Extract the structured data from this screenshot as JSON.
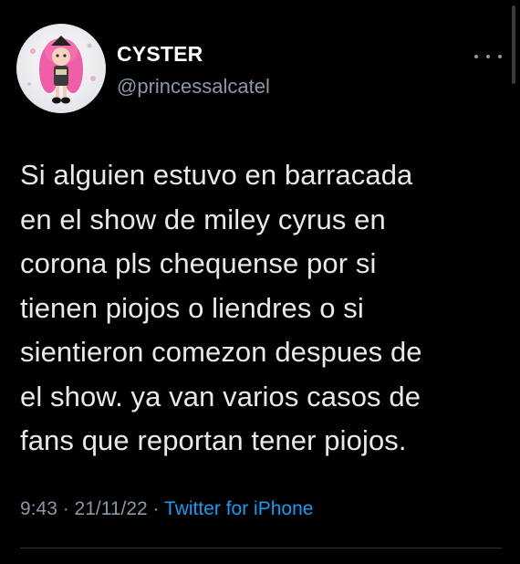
{
  "user": {
    "display_name": "CYSTER",
    "handle": "@princessalcatel"
  },
  "tweet": {
    "text": "Si alguien estuvo en barracada\nen el show de miley cyrus en\ncorona pls chequense por si\ntienen piojos o liendres o si\nsientieron comezon despues de\nel show. ya van varios casos de\nfans que reportan tener piojos."
  },
  "meta": {
    "time": "9:43",
    "separator1": " · ",
    "date": "21/11/22",
    "separator2": " · ",
    "source": "Twitter for iPhone"
  },
  "icons": {
    "more": "more-horizontal-icon",
    "avatar": "profile-avatar-illustration"
  },
  "colors": {
    "background": "#000000",
    "text": "#e7e9ea",
    "secondary": "#8b98a5",
    "link": "#1d9bf0"
  }
}
